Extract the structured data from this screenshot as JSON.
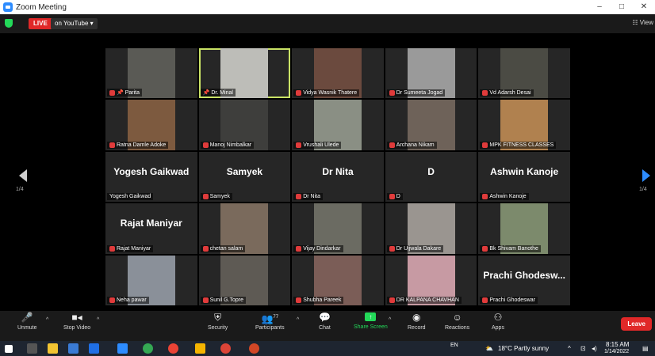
{
  "window": {
    "title": "Zoom Meeting",
    "controls": [
      "–",
      "□",
      "✕"
    ]
  },
  "topbar": {
    "live": "LIVE",
    "live_on": "on YouTube ▾",
    "view": "☷ View"
  },
  "gallery": {
    "tiles": [
      {
        "name": "Parita",
        "bg": "#5a5a55",
        "muted": true,
        "pin": true
      },
      {
        "name": "Dr. Minal",
        "bg": "#bdbdb8",
        "muted": false,
        "pin": true,
        "active": true
      },
      {
        "name": "Vidya Wasnik Thatere",
        "bg": "#6b4a3e",
        "muted": true
      },
      {
        "name": "Dr Sumeeta Jogad",
        "bg": "#9a9a9a",
        "muted": true
      },
      {
        "name": "Vd Adarsh Desai",
        "bg": "#4b4b44",
        "muted": true
      },
      {
        "name": "Ratna Damle Adoke",
        "bg": "#7d5a3f",
        "muted": true
      },
      {
        "name": "Manoj Nimbalkar",
        "bg": "#3e3e3c",
        "muted": true
      },
      {
        "name": "Vrushali Ulede",
        "bg": "#8a8f84",
        "muted": true
      },
      {
        "name": "Archana Nikam",
        "bg": "#6e6259",
        "muted": true
      },
      {
        "name": "MPK FITNESS CLASSES",
        "bg": "#b0814f",
        "muted": true
      },
      {
        "name": "Yogesh Gaikwad",
        "big": "Yogesh Gaikwad",
        "muted": false
      },
      {
        "name": "Samyek",
        "big": "Samyek",
        "muted": true
      },
      {
        "name": "Dr Nita",
        "big": "Dr Nita",
        "muted": true
      },
      {
        "name": "D",
        "big": "D",
        "muted": true
      },
      {
        "name": "Ashwin Kanoje",
        "big": "Ashwin Kanoje",
        "muted": true
      },
      {
        "name": "Rajat Maniyar",
        "big": "Rajat Maniyar",
        "muted": true
      },
      {
        "name": "chetan salam",
        "bg": "#7a6a5c",
        "muted": true
      },
      {
        "name": "Vijay Dindarkar",
        "bg": "#6b6b62",
        "muted": true
      },
      {
        "name": "Dr Ujjwala Dakare",
        "bg": "#9a9590",
        "muted": true
      },
      {
        "name": "Bk Shivam Banothe",
        "bg": "#7c8a6c",
        "muted": true
      },
      {
        "name": "Neha pawar",
        "bg": "#8a9099",
        "muted": true
      },
      {
        "name": "Sunil G.Topre",
        "bg": "#5e5a54",
        "muted": true
      },
      {
        "name": "Shubha Pareek",
        "bg": "#7b5d57",
        "muted": true
      },
      {
        "name": "DR KALPANA CHAVHAN",
        "bg": "#c79aa3",
        "muted": true
      },
      {
        "name": "Prachi Ghodeswar",
        "big": "Prachi  Ghodesw...",
        "muted": true
      }
    ]
  },
  "nav": {
    "left_page": "1/4",
    "right_page": "1/4"
  },
  "toolbar": {
    "unmute": "Unmute",
    "stop_video": "Stop Video",
    "security": "Security",
    "participants": "Participants",
    "participants_count": "77",
    "chat": "Chat",
    "share": "Share Screen",
    "record": "Record",
    "reactions": "Reactions",
    "apps": "Apps",
    "leave": "Leave"
  },
  "taskbar": {
    "lang": "EN",
    "weather": "18°C  Partly sunny",
    "time": "8:15 AM",
    "date": "1/14/2022"
  }
}
